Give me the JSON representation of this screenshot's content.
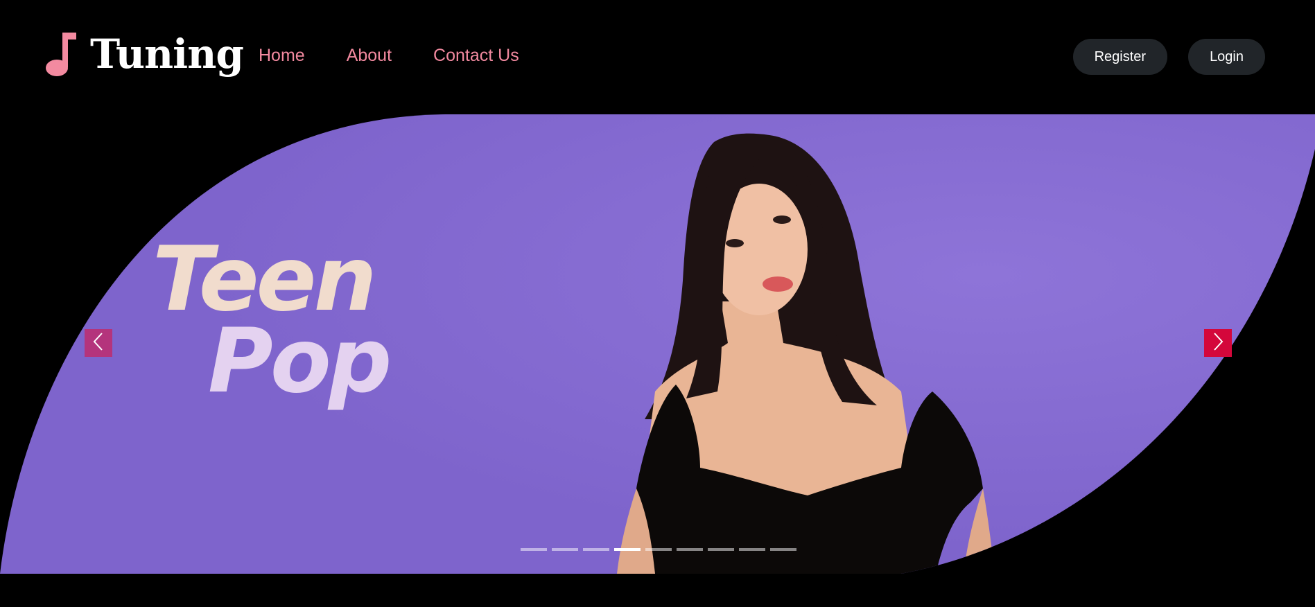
{
  "brand": {
    "name": "Tuning",
    "icon": "music-note-icon",
    "color": "#f38aa0"
  },
  "nav": {
    "links": [
      {
        "label": "Home"
      },
      {
        "label": "About"
      },
      {
        "label": "Contact Us"
      }
    ]
  },
  "auth": {
    "register_label": "Register",
    "login_label": "Login"
  },
  "carousel": {
    "slide": {
      "title_line1": "Teen",
      "title_line2": "Pop",
      "background_color": "#866bd0"
    },
    "prev_icon": "chevron-left-icon",
    "next_icon": "chevron-right-icon",
    "indicator_count": 9,
    "active_index": 3
  }
}
